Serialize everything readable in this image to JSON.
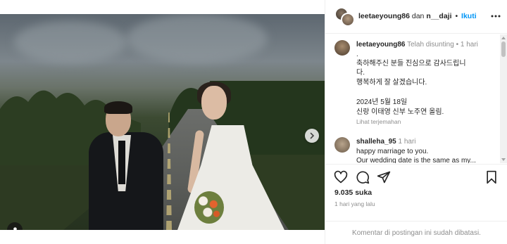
{
  "header": {
    "username": "leetaeyoung86",
    "joiner": "dan",
    "collaborator": "n__daji",
    "separator": "•",
    "follow_label": "Ikuti",
    "more_icon": "more-horizontal-icon"
  },
  "caption": {
    "username": "leetaeyoung86",
    "meta": "Telah disunting",
    "meta_sep": "•",
    "time": "1 hari",
    "lines": [
      ".",
      "축하해주신 분들 진심으로 감사드립니",
      "다.",
      "행복하게 잘 살겠습니다.",
      "2024년 5월 18일",
      "신랑 이태영 신부 노주연 올림."
    ],
    "translate_label": "Lihat terjemahan"
  },
  "comment": {
    "username": "shalleha_95",
    "time": "1 hari",
    "lines": [
      "happy marriage to you.",
      "Our wedding date is the same as my..."
    ]
  },
  "actions": {
    "like_icon": "heart-icon",
    "comment_icon": "comment-icon",
    "share_icon": "send-icon",
    "save_icon": "bookmark-icon"
  },
  "likes": "9.035 suka",
  "date": "1 hari yang lalu",
  "footer": "Komentar di postingan ini sudah dibatasi.",
  "carousel": {
    "total_slides": 10,
    "active_slide": 1
  },
  "colors": {
    "link": "#0095f6",
    "muted": "#8e8e8e",
    "text": "#262626",
    "dot_active": "#3c8dff"
  }
}
